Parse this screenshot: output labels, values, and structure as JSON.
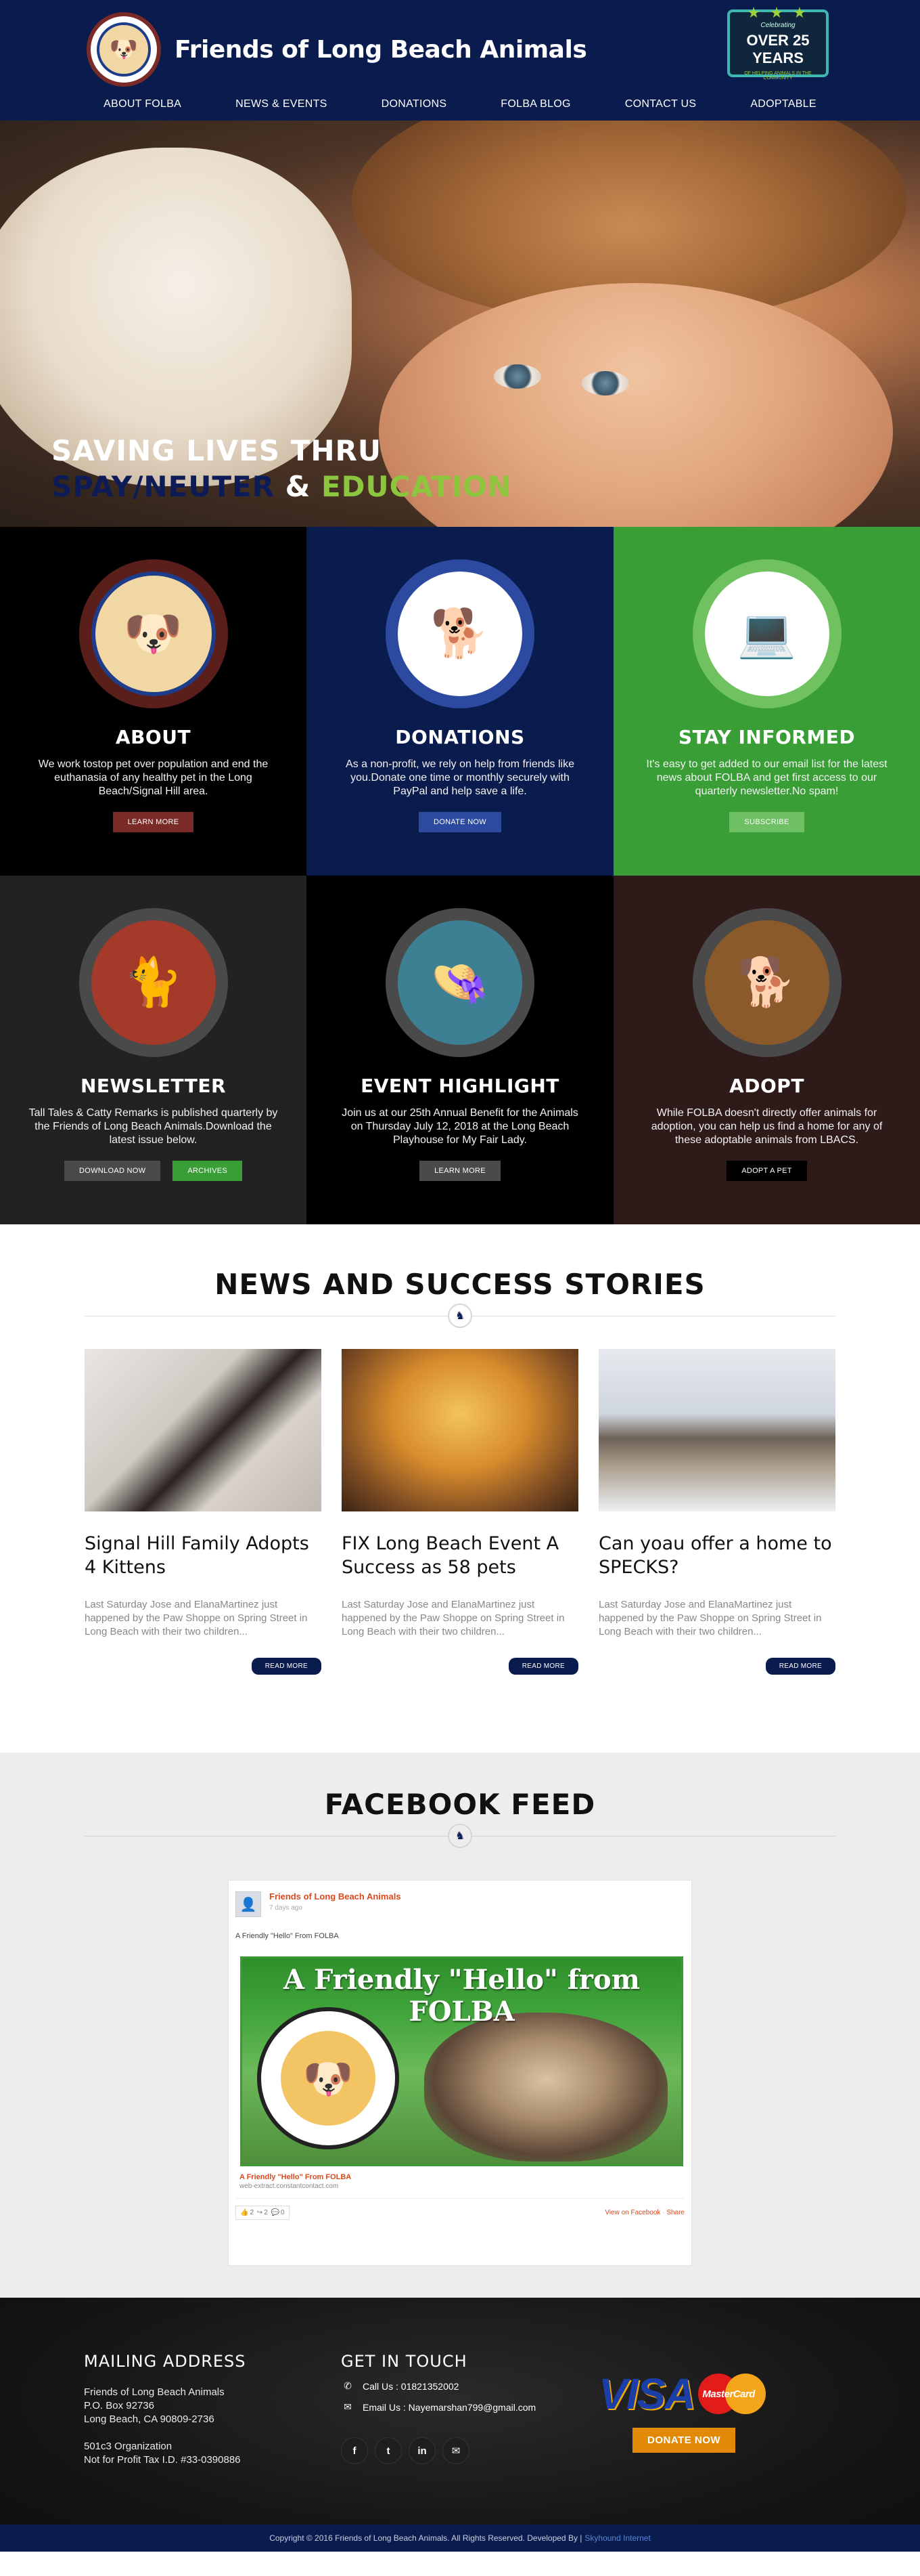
{
  "header": {
    "site_title": "Friends of Long Beach Animals",
    "logo_text": "FRIENDS OF LONG BEACH ANIMALS",
    "anniversary": {
      "small": "Celebrating",
      "big": "OVER 25 YEARS",
      "tiny": "OF HELPING ANIMALS IN THE COMMUNITY"
    },
    "nav": [
      "ABOUT FOLBA",
      "NEWS & EVENTS",
      "DONATIONS",
      "FOLBA BLOG",
      "CONTACT US",
      "ADOPTABLE"
    ]
  },
  "hero": {
    "line1": "SAVING LIVES THRU",
    "line2_part1": "SPAY/NEUTER",
    "line2_amp": "&",
    "line2_part2": "EDUCATION"
  },
  "tiles": [
    {
      "id": "about",
      "title": "ABOUT",
      "text": "We work tostop pet over population and end the euthanasia of any healthy pet in the Long Beach/Signal Hill area.",
      "buttons": [
        "LEARN MORE"
      ],
      "bg": "#000000",
      "ring": "#5a1e1b",
      "btn": "#7a2b27",
      "icon": "logo-icon"
    },
    {
      "id": "donations",
      "title": "DONATIONS",
      "text": "As a non-profit, we rely on help from friends like you.Donate one time or monthly securely with PayPal and help save a life.",
      "buttons": [
        "DONATE NOW"
      ],
      "bg": "#0a1b4d",
      "ring": "#2b4aa0",
      "btn": "#2b4aa0",
      "icon": "dog-newspaper-icon"
    },
    {
      "id": "stay-informed",
      "title": "STAY INFORMED",
      "text": "It's easy to get added to our email list for the latest news about FOLBA and get first access to our quarterly newsletter.No spam!",
      "buttons": [
        "SUBSCRIBE"
      ],
      "bg": "#3a9e37",
      "ring": "#6fc25f",
      "btn": "#6fbf65",
      "icon": "dog-laptop-icon"
    },
    {
      "id": "newsletter",
      "title": "NEWSLETTER",
      "text": "Tall Tales & Catty Remarks is published quarterly by the Friends of Long Beach Animals.Download the latest issue below.",
      "buttons": [
        "DOWNLOAD NOW",
        "ARCHIVES"
      ],
      "bg": "#222222",
      "ring": "#4a4a4a",
      "btn": "#4a4a4a",
      "btn2": "#3a9e37",
      "icon": "cat-icon"
    },
    {
      "id": "event-highlight",
      "title": "EVENT HIGHLIGHT",
      "text": "Join us at our 25th Annual Benefit for the Animals on Thursday July 12, 2018 at the Long Beach Playhouse for My Fair Lady.",
      "buttons": [
        "LEARN MORE"
      ],
      "bg": "#000000",
      "ring": "#4a4a4a",
      "btn": "#4a4a4a",
      "icon": "lady-hat-icon"
    },
    {
      "id": "adopt",
      "title": "ADOPT",
      "text": "While FOLBA doesn't directly offer animals for adoption, you can help us find a home for any of these adoptable animals from LBACS.",
      "buttons": [
        "ADOPT A PET"
      ],
      "bg": "#2e1a18",
      "ring": "#4a4a4a",
      "btn": "#000000",
      "icon": "golden-dog-icon"
    }
  ],
  "news": {
    "title": "NEWS AND SUCCESS STORIES",
    "cards": [
      {
        "title": "Signal Hill Family Adopts 4 Kittens",
        "excerpt": "Last Saturday Jose and ElanaMartinez just happened by the Paw Shoppe on Spring Street in Long Beach with their two children...",
        "button": "READ MORE"
      },
      {
        "title": "FIX Long Beach Event A Success as 58 pets",
        "excerpt": "Last Saturday Jose and ElanaMartinez just happened by the Paw Shoppe on Spring Street in Long Beach with their two children...",
        "button": "READ MORE"
      },
      {
        "title": "Can yoau offer a home to SPECKS?",
        "excerpt": "Last Saturday Jose and ElanaMartinez just happened by the Paw Shoppe on Spring Street in Long Beach with their two children...",
        "button": "READ MORE"
      }
    ]
  },
  "facebook": {
    "title": "FACEBOOK FEED",
    "page_name": "Friends of Long Beach Animals",
    "time": "7 days ago",
    "message": "A Friendly \"Hello\" From FOLBA",
    "image_headline": "A Friendly \"Hello\" from FOLBA",
    "link_title": "A Friendly \"Hello\" From FOLBA",
    "link_url": "web-extract.constantcontact.com",
    "likes": "2",
    "shares": "2",
    "comments": "0",
    "view_on_facebook": "View on Facebook",
    "share": "Share"
  },
  "footer": {
    "mailing_title": "MAILING ADDRESS",
    "address_lines": [
      "Friends of Long Beach Animals",
      "P.O. Box 92736",
      "Long Beach, CA 90809-2736"
    ],
    "org_lines": [
      "501c3 Organization",
      "Not for Profit Tax I.D. #33-0390886"
    ],
    "contact_title": "GET IN TOUCH",
    "call": "Call Us : 01821352002",
    "email": "Email Us : Nayemarshan799@gmail.com",
    "socials": [
      "f",
      "t",
      "in",
      "✉"
    ],
    "visa": "VISA",
    "mastercard": "MasterCard",
    "donate_button": "DONATE NOW",
    "copyright": "Copyright © 2016 Friends of Long Beach Animals. All Rights Reserved. Developed By |",
    "developer": "Skyhound Internet"
  }
}
